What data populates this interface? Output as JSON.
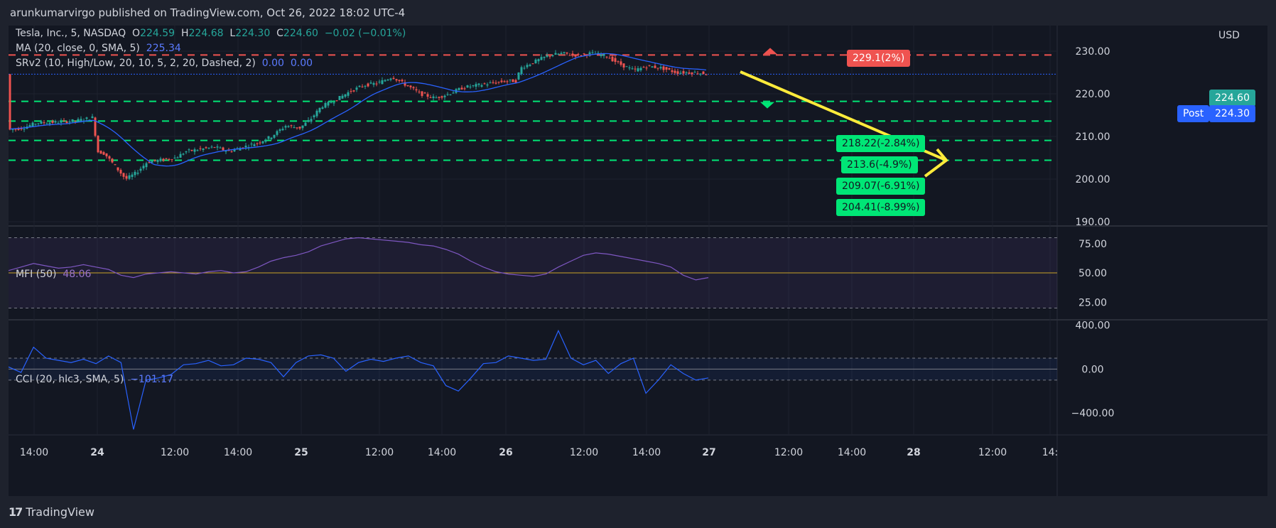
{
  "header": {
    "publisher_line": "arunkumarvirgo published on TradingView.com, Oct 26, 2022 18:02 UTC-4"
  },
  "legend": {
    "symbol": "Tesla, Inc., 5, NASDAQ",
    "o_label": "O",
    "o_value": "224.59",
    "h_label": "H",
    "h_value": "224.68",
    "l_label": "L",
    "l_value": "224.30",
    "c_label": "C",
    "c_value": "224.60",
    "change": "−0.02 (−0.01%)",
    "ma_label": "MA (20, close, 0, SMA, 5)",
    "ma_value": "225.34",
    "srv2_label": "SRv2 (10, High/Low, 20, 10, 5, 2, 20, Dashed, 2)",
    "srv2_value1": "0.00",
    "srv2_value2": "0.00",
    "mfi_label": "MFI (50)",
    "mfi_value": "48.06",
    "cci_label": "CCI (20, hlc3, SMA, 5)",
    "cci_value": "−101.17"
  },
  "price_tags": {
    "currency": "USD",
    "last_price": "224.60",
    "post_label": "Post",
    "post_price": "224.30"
  },
  "levels": {
    "resistance": {
      "price": 229.1,
      "label": "229.1(2%)"
    },
    "supports": [
      {
        "price": 218.22,
        "label": "218.22(-2.84%)"
      },
      {
        "price": 213.6,
        "label": "213.6(-4.9%)"
      },
      {
        "price": 209.07,
        "label": "209.07(-6.91%)"
      },
      {
        "price": 204.41,
        "label": "204.41(-8.99%)"
      }
    ]
  },
  "footer": {
    "brand": "TradingView",
    "logo": "17"
  },
  "colors": {
    "background": "#131722",
    "up": "#26a69a",
    "down": "#ef5350",
    "ma": "#2962ff",
    "resistance": "#ef5350",
    "support": "#00e676",
    "arrow": "#ffeb3b",
    "mfi": "#7e57c2",
    "cci": "#2962ff"
  },
  "chart_data": [
    {
      "type": "candlestick",
      "title": "Tesla, Inc., 5, NASDAQ",
      "y_axis": {
        "ticks": [
          "230.00",
          "220.00",
          "210.00",
          "200.00",
          "190.00"
        ],
        "range": [
          189,
          236
        ],
        "unit": "USD"
      },
      "x_axis": {
        "ticks": [
          "14:00",
          "24",
          "12:00",
          "14:00",
          "25",
          "12:00",
          "14:00",
          "26",
          "12:00",
          "14:00",
          "27",
          "12:00",
          "14:00",
          "28",
          "12:00",
          "14:"
        ]
      },
      "price_path_approx": [
        [
          0,
          211.5
        ],
        [
          20,
          212.0
        ],
        [
          40,
          213.2
        ],
        [
          60,
          213.3
        ],
        [
          80,
          213.5
        ],
        [
          100,
          213.8
        ],
        [
          120,
          214.5
        ],
        [
          124,
          206.5
        ],
        [
          135,
          206.0
        ],
        [
          150,
          203.0
        ],
        [
          165,
          200.0
        ],
        [
          180,
          201.5
        ],
        [
          195,
          204.0
        ],
        [
          215,
          204.5
        ],
        [
          235,
          205.0
        ],
        [
          250,
          206.5
        ],
        [
          270,
          207.0
        ],
        [
          290,
          207.5
        ],
        [
          310,
          206.5
        ],
        [
          330,
          207.5
        ],
        [
          350,
          208.5
        ],
        [
          370,
          210.0
        ],
        [
          390,
          212.5
        ],
        [
          410,
          212.0
        ],
        [
          425,
          214.0
        ],
        [
          440,
          217.0
        ],
        [
          460,
          218.5
        ],
        [
          480,
          220.5
        ],
        [
          500,
          222.0
        ],
        [
          520,
          222.5
        ],
        [
          540,
          224.0
        ],
        [
          560,
          222.0
        ],
        [
          580,
          220.0
        ],
        [
          600,
          219.0
        ],
        [
          620,
          220.0
        ],
        [
          640,
          221.5
        ],
        [
          660,
          222.0
        ],
        [
          680,
          222.5
        ],
        [
          700,
          223.0
        ],
        [
          715,
          223.0
        ],
        [
          720,
          226.0
        ],
        [
          740,
          227.5
        ],
        [
          760,
          229.0
        ],
        [
          780,
          229.5
        ],
        [
          800,
          229.0
        ],
        [
          820,
          229.5
        ],
        [
          840,
          229.0
        ],
        [
          860,
          227.0
        ],
        [
          880,
          225.5
        ],
        [
          900,
          226.5
        ],
        [
          920,
          226.0
        ],
        [
          940,
          225.0
        ],
        [
          960,
          225.0
        ],
        [
          980,
          224.8
        ],
        [
          990,
          224.6
        ]
      ],
      "ma_value_last": 225.34,
      "last_price": 224.6,
      "post_price": 224.3,
      "resistance": 229.1,
      "supports": [
        218.22,
        213.6,
        209.07,
        204.41
      ],
      "projection": {
        "from": 224.5,
        "to": 204.41
      }
    },
    {
      "type": "line",
      "title": "MFI (50)",
      "last_value": 48.06,
      "y_axis": {
        "ticks": [
          "75.00",
          "50.00",
          "25.00"
        ],
        "range": [
          10,
          90
        ]
      },
      "bands": [
        20,
        50,
        80
      ],
      "series": [
        {
          "values": [
            52,
            55,
            58,
            56,
            54,
            55,
            57,
            55,
            53,
            48,
            46,
            49,
            50,
            51,
            50,
            49,
            51,
            52,
            50,
            51,
            55,
            60,
            63,
            65,
            68,
            73,
            76,
            79,
            80,
            79,
            78,
            77,
            76,
            74,
            73,
            70,
            66,
            60,
            55,
            51,
            49,
            48,
            47,
            49,
            55,
            60,
            65,
            67,
            66,
            64,
            62,
            60,
            58,
            55,
            48,
            44,
            46
          ]
        }
      ]
    },
    {
      "type": "line",
      "title": "CCI (20, hlc3, SMA, 5)",
      "last_value": -101.17,
      "y_axis": {
        "ticks": [
          "400.00",
          "0.00",
          "−400.00"
        ],
        "range": [
          -600,
          450
        ]
      },
      "bands": [
        -100,
        0,
        100
      ],
      "series": [
        {
          "values": [
            20,
            -30,
            200,
            100,
            80,
            60,
            90,
            50,
            120,
            60,
            -550,
            -100,
            -80,
            -50,
            40,
            50,
            80,
            30,
            40,
            100,
            90,
            60,
            -70,
            60,
            120,
            130,
            100,
            -20,
            60,
            90,
            70,
            100,
            120,
            60,
            30,
            -150,
            -200,
            -80,
            50,
            60,
            120,
            100,
            80,
            90,
            350,
            100,
            40,
            80,
            -40,
            50,
            100,
            -220,
            -100,
            40,
            -40,
            -100,
            -80
          ]
        }
      ]
    }
  ]
}
